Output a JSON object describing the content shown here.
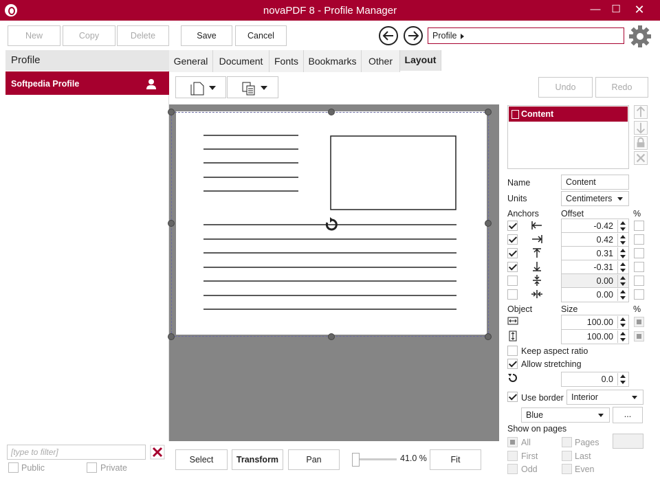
{
  "window": {
    "title": "novaPDF 8 - Profile Manager"
  },
  "toolbar": {
    "new": "New",
    "copy": "Copy",
    "delete": "Delete",
    "save": "Save",
    "cancel": "Cancel"
  },
  "breadcrumb": {
    "text": "Profile"
  },
  "left": {
    "header": "Profile",
    "profiles": [
      {
        "name": "Softpedia Profile"
      }
    ],
    "filter_placeholder": "[type to filter]",
    "public_label": "Public",
    "private_label": "Private"
  },
  "tabs": [
    "General",
    "Document",
    "Fonts",
    "Bookmarks",
    "Other",
    "Layout"
  ],
  "active_tab": "Layout",
  "layout": {
    "undo": "Undo",
    "redo": "Redo"
  },
  "content_list": [
    "Content"
  ],
  "props": {
    "name_label": "Name",
    "name_value": "Content",
    "units_label": "Units",
    "units_value": "Centimeters",
    "anchors_label": "Anchors",
    "offset_label": "Offset",
    "percent": "%",
    "anchors": [
      {
        "checked": true,
        "value": "-0.42",
        "editable": true
      },
      {
        "checked": true,
        "value": "0.42",
        "editable": true
      },
      {
        "checked": true,
        "value": "0.31",
        "editable": true
      },
      {
        "checked": true,
        "value": "-0.31",
        "editable": true
      },
      {
        "checked": false,
        "value": "0.00",
        "editable": false
      },
      {
        "checked": false,
        "value": "0.00",
        "editable": false
      }
    ],
    "object_label": "Object",
    "size_label": "Size",
    "size_w": "100.00",
    "size_h": "100.00",
    "keep_aspect": "Keep aspect ratio",
    "allow_stretch": "Allow stretching",
    "rotation": "0.0",
    "use_border": "Use border",
    "border_style": "Interior",
    "border_color": "Blue",
    "more": "...",
    "show_on_pages": "Show on pages",
    "pages": {
      "all": "All",
      "pages": "Pages",
      "first": "First",
      "last": "Last",
      "odd": "Odd",
      "even": "Even"
    }
  },
  "bottom": {
    "select": "Select",
    "transform": "Transform",
    "pan": "Pan",
    "zoom": "41.0 %",
    "fit": "Fit"
  },
  "colors": {
    "accent": "#a6002e",
    "canvas": "#858585"
  }
}
